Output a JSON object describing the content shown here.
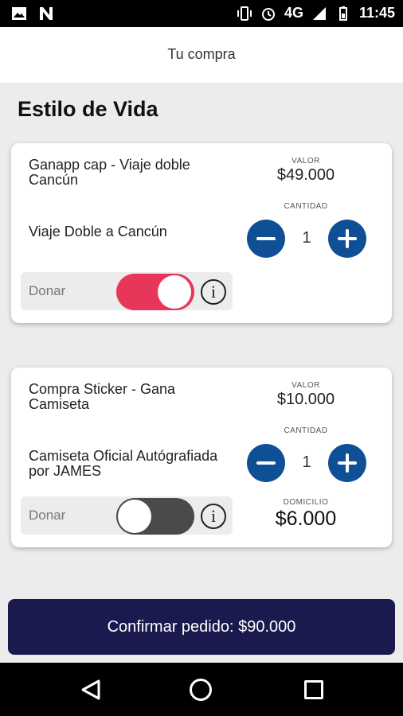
{
  "status_bar": {
    "network": "4G",
    "time": "11:45"
  },
  "header": {
    "title": "Tu compra"
  },
  "section": {
    "title": "Estilo de Vida"
  },
  "cards": [
    {
      "name": "Ganapp cap -  Viaje doble Cancún",
      "description": "Viaje Doble a Cancún",
      "valor_label": "VALOR",
      "valor": "$49.000",
      "cantidad_label": "CANTIDAD",
      "quantity": "1",
      "donate_label": "Donar",
      "donate_on": true
    },
    {
      "name": "Compra Sticker - Gana Camiseta",
      "description": "Camiseta Oficial Autógrafiada por JAMES",
      "valor_label": "VALOR",
      "valor": "$10.000",
      "cantidad_label": "CANTIDAD",
      "quantity": "1",
      "donate_label": "Donar",
      "donate_on": false,
      "domicilio_label": "DOMICILIO",
      "domicilio": "$6.000"
    }
  ],
  "confirm_button": {
    "label": "Confirmar pedido: $90.000"
  },
  "colors": {
    "accent_blue": "#0e4f96",
    "toggle_on": "#e8365a",
    "confirm_bg": "#1b1a4f"
  },
  "icons": [
    "image-icon",
    "notification-n-icon",
    "vibrate-icon",
    "alarm-icon",
    "signal-icon",
    "battery-icon",
    "info-icon",
    "back-icon",
    "home-icon",
    "recent-apps-icon"
  ]
}
